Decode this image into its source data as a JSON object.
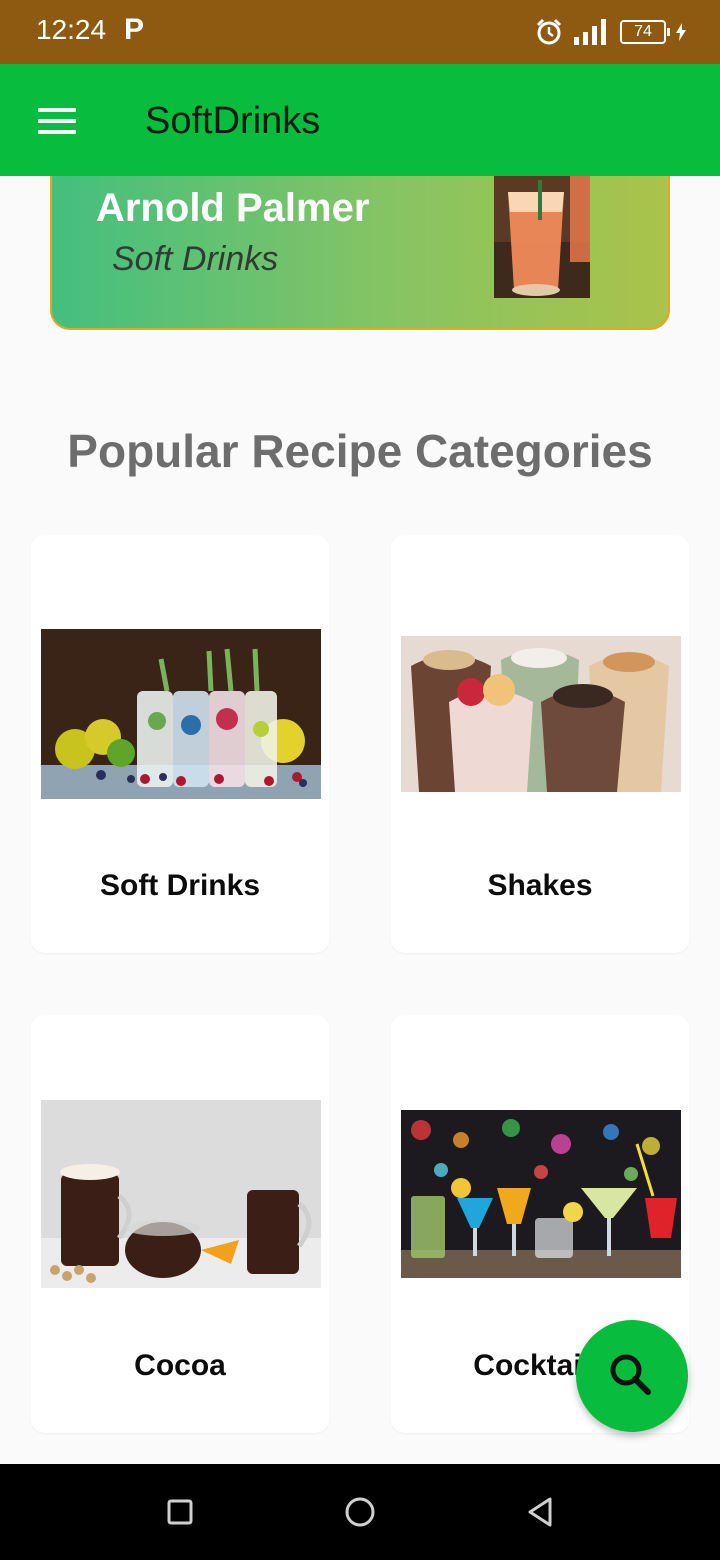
{
  "status_bar": {
    "time": "12:24",
    "notification_letter": "P",
    "battery_level": "74"
  },
  "app_bar": {
    "title": "SoftDrinks",
    "menu_icon": "hamburger-menu-icon"
  },
  "featured": {
    "title": "Arnold Palmer",
    "category": "Soft Drinks"
  },
  "section": {
    "title": "Popular Recipe Categories"
  },
  "categories": [
    {
      "label": "Soft Drinks"
    },
    {
      "label": "Shakes"
    },
    {
      "label": "Cocoa"
    },
    {
      "label": "Cocktails"
    }
  ],
  "fab": {
    "icon": "search-icon"
  },
  "colors": {
    "status_bar": "#8e5a12",
    "app_bar": "#08bd3e",
    "accent_border": "#e5a81b",
    "section_title": "#6d6d6d"
  }
}
